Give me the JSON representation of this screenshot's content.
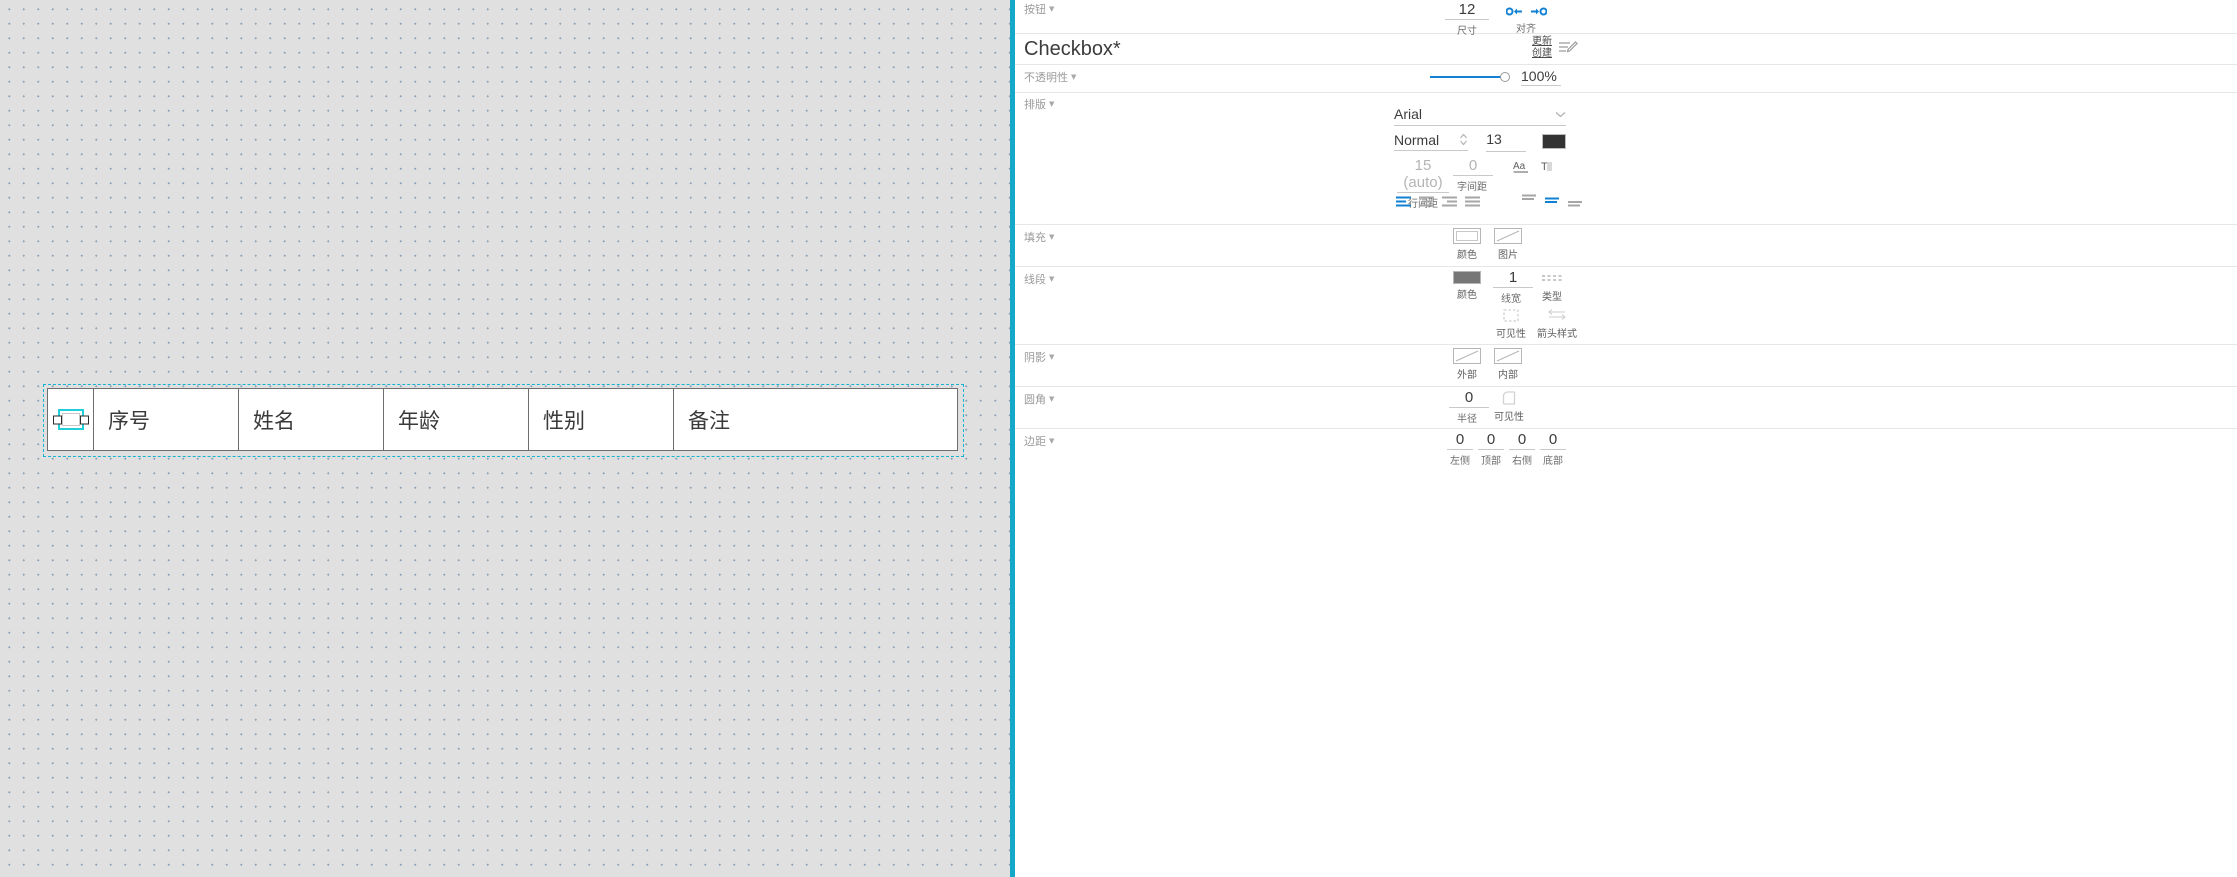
{
  "canvas": {
    "widget_type": "table",
    "table": {
      "cells": [
        {
          "name": "checkbox-cell",
          "text": ""
        },
        {
          "name": "header-index",
          "text": "序号"
        },
        {
          "name": "header-name",
          "text": "姓名"
        },
        {
          "name": "header-age",
          "text": "年龄"
        },
        {
          "name": "header-gender",
          "text": "性别"
        },
        {
          "name": "header-remark",
          "text": "备注"
        }
      ]
    },
    "selection_color": "#16b4cf",
    "divider_color": "#16a8c8"
  },
  "inspector": {
    "sections": {
      "button": {
        "label": "按钮",
        "size": {
          "value": "12",
          "caption": "尺寸"
        },
        "align": {
          "caption": "对齐"
        }
      },
      "title": {
        "widget_name": "Checkbox*",
        "update_label": "更新",
        "create_label": "创建"
      },
      "opacity": {
        "label": "不透明性",
        "value": "100%",
        "percent": 100,
        "track_color": "#1281d3"
      },
      "typography": {
        "label": "排版",
        "font_family": "Arial",
        "font_style": "Normal",
        "font_size": "13",
        "font_color": "#333333",
        "line_height": {
          "value": "15 (auto)",
          "caption": "行间距"
        },
        "letter_spacing": {
          "value": "0",
          "caption": "字间距"
        },
        "case_icon": "Aa",
        "underline_icon": "T",
        "h_align_selected": 0,
        "v_align_selected": 1,
        "accent_color": "#1281d3"
      },
      "fill": {
        "label": "填充",
        "color": {
          "caption": "颜色"
        },
        "image": {
          "caption": "图片"
        }
      },
      "line": {
        "label": "线段",
        "color": {
          "caption": "颜色",
          "swatch": "#777777"
        },
        "width": {
          "value": "1",
          "caption": "线宽"
        },
        "type": {
          "caption": "类型"
        },
        "visibility": {
          "caption": "可见性"
        },
        "arrow_style": {
          "caption": "箭头样式"
        }
      },
      "shadow": {
        "label": "阴影",
        "outer": {
          "caption": "外部"
        },
        "inner": {
          "caption": "内部"
        }
      },
      "corner": {
        "label": "圆角",
        "radius": {
          "value": "0",
          "caption": "半径"
        },
        "visibility": {
          "caption": "可见性"
        }
      },
      "padding": {
        "label": "边距",
        "values": [
          {
            "value": "0",
            "caption": "左侧"
          },
          {
            "value": "0",
            "caption": "顶部"
          },
          {
            "value": "0",
            "caption": "右侧"
          },
          {
            "value": "0",
            "caption": "底部"
          }
        ]
      }
    }
  }
}
